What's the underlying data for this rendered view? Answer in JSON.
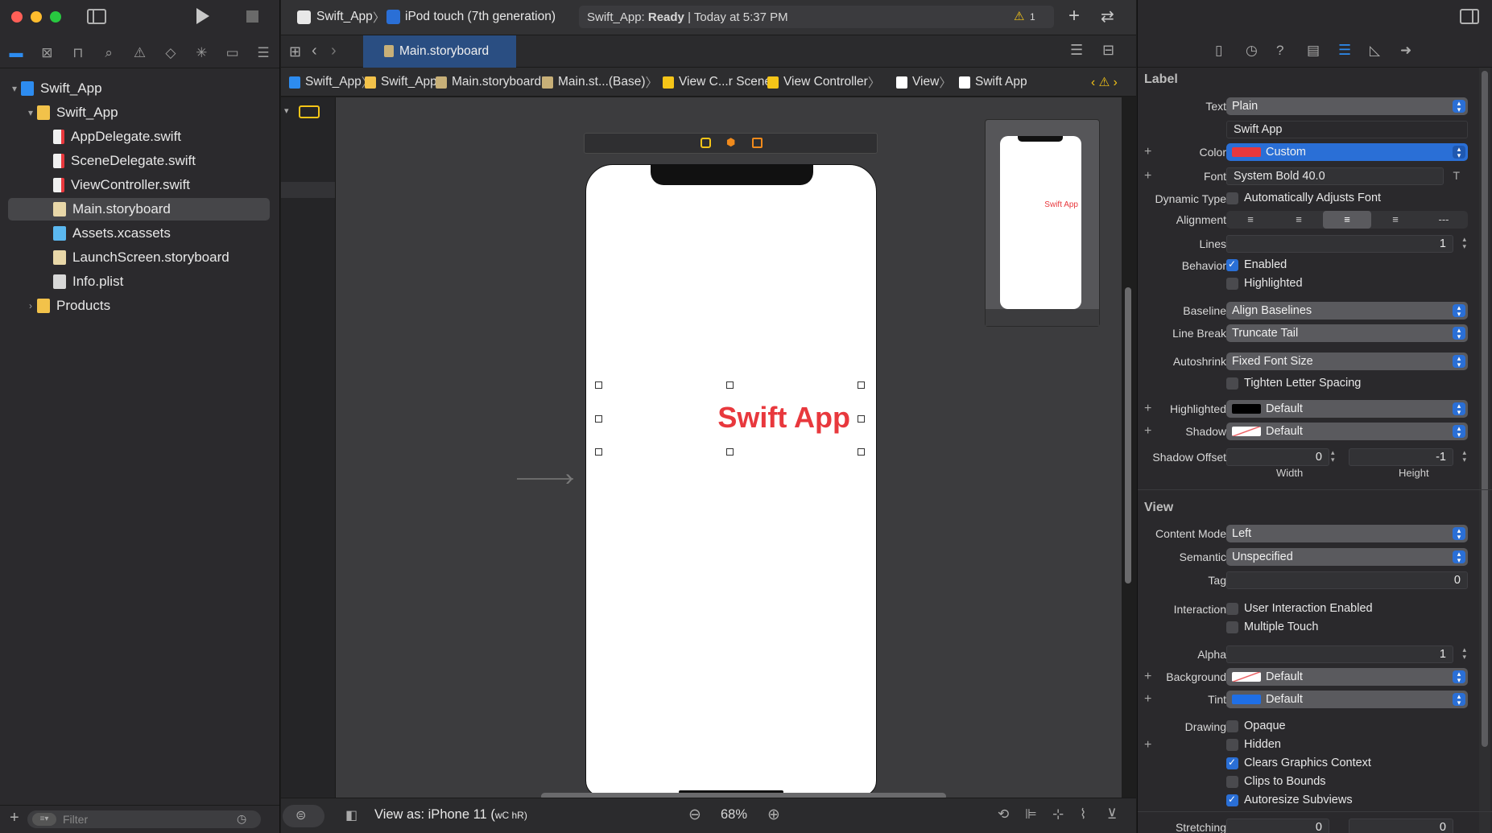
{
  "toolbar": {
    "scheme": "Swift_App",
    "destination": "iPod touch (7th generation)",
    "status_project": "Swift_App: ",
    "status_state": "Ready",
    "status_time": "| Today at 5:37 PM",
    "warning_count": "1"
  },
  "navigator": {
    "items": [
      {
        "label": "Swift_App",
        "indent": 0,
        "kind": "project"
      },
      {
        "label": "Swift_App",
        "indent": 1,
        "kind": "folder"
      },
      {
        "label": "AppDelegate.swift",
        "indent": 2,
        "kind": "swift"
      },
      {
        "label": "SceneDelegate.swift",
        "indent": 2,
        "kind": "swift"
      },
      {
        "label": "ViewController.swift",
        "indent": 2,
        "kind": "swift"
      },
      {
        "label": "Main.storyboard",
        "indent": 2,
        "kind": "storyboard"
      },
      {
        "label": "Assets.xcassets",
        "indent": 2,
        "kind": "assets"
      },
      {
        "label": "LaunchScreen.storyboard",
        "indent": 2,
        "kind": "storyboard"
      },
      {
        "label": "Info.plist",
        "indent": 2,
        "kind": "plist"
      },
      {
        "label": "Products",
        "indent": 1,
        "kind": "folder"
      }
    ],
    "filter_placeholder": "Filter"
  },
  "editor": {
    "tab": "Main.storyboard",
    "breadcrumbs": [
      "Swift_App",
      "Swift_App",
      "Main.storyboard",
      "Main.st...(Base)",
      "View C...r Scene",
      "View Controller",
      "View",
      "Swift App"
    ],
    "label_text": "Swift App",
    "label_color": "#e8383d",
    "view_as": "View as: iPhone 11 (",
    "view_as_size": "wC hR)",
    "zoom": "68%"
  },
  "inspector": {
    "label_section": "Label",
    "text_label": "Text",
    "text_type": "Plain",
    "text_value": "Swift App",
    "color_label": "Color",
    "color_value": "Custom",
    "font_label": "Font",
    "font_value": "System Bold 40.0",
    "dynamic_label": "Dynamic Type",
    "dynamic_value": "Automatically Adjusts Font",
    "alignment_label": "Alignment",
    "lines_label": "Lines",
    "lines_value": "1",
    "behavior_label": "Behavior",
    "enabled_label": "Enabled",
    "highlighted_chk_label": "Highlighted",
    "baseline_label": "Baseline",
    "baseline_value": "Align Baselines",
    "linebreak_label": "Line Break",
    "linebreak_value": "Truncate Tail",
    "autoshrink_label": "Autoshrink",
    "autoshrink_value": "Fixed Font Size",
    "tighten_label": "Tighten Letter Spacing",
    "highlighted_label": "Highlighted",
    "highlighted_value": "Default",
    "shadow_label": "Shadow",
    "shadow_value": "Default",
    "shadow_offset_label": "Shadow Offset",
    "shadow_w": "0",
    "shadow_h": "-1",
    "width_label": "Width",
    "height_label": "Height",
    "view_section": "View",
    "content_mode_label": "Content Mode",
    "content_mode_value": "Left",
    "semantic_label": "Semantic",
    "semantic_value": "Unspecified",
    "tag_label": "Tag",
    "tag_value": "0",
    "interaction_label": "Interaction",
    "user_interaction_label": "User Interaction Enabled",
    "multiple_touch_label": "Multiple Touch",
    "alpha_label": "Alpha",
    "alpha_value": "1",
    "background_label": "Background",
    "background_value": "Default",
    "tint_label": "Tint",
    "tint_value": "Default",
    "drawing_label": "Drawing",
    "opaque_label": "Opaque",
    "hidden_label": "Hidden",
    "clears_label": "Clears Graphics Context",
    "clips_label": "Clips to Bounds",
    "autoresize_label": "Autoresize Subviews",
    "stretching_label": "Stretching",
    "stretch_x": "0",
    "stretch_y": "0"
  },
  "colors": {
    "accent": "#2a6fd6",
    "custom_red": "#e8383d",
    "tint_blue": "#1f6fe6"
  }
}
